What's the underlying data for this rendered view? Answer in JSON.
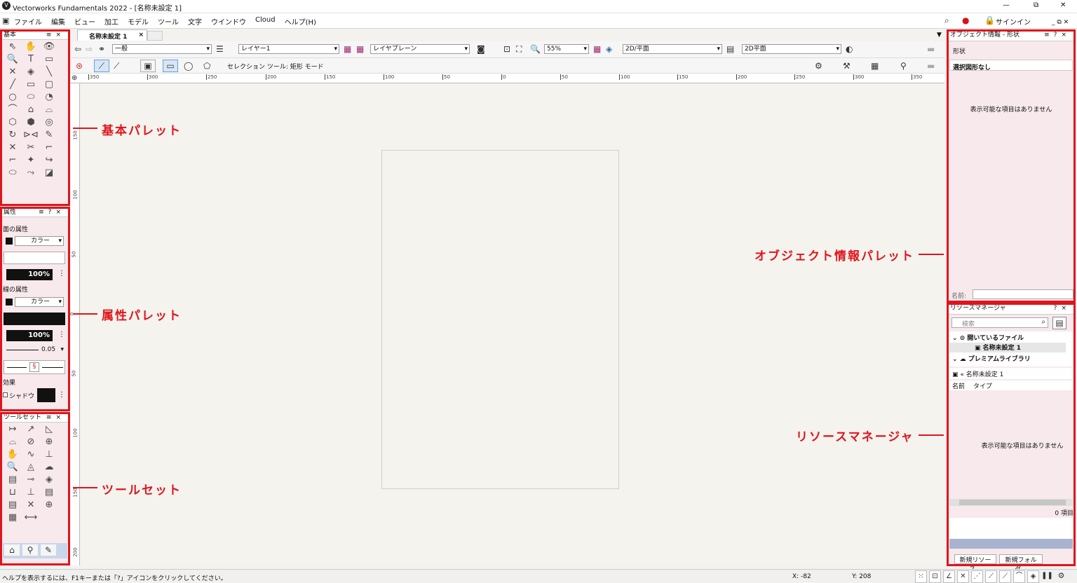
{
  "app": {
    "title": "Vectorworks Fundamentals 2022 - [名称未設定 1]",
    "signin": "サインイン",
    "window_controls": [
      "—",
      "⧉",
      "✕"
    ]
  },
  "menu": [
    "ファイル",
    "編集",
    "ビュー",
    "加工",
    "モデル",
    "ツール",
    "文字",
    "ウインドウ",
    "Cloud",
    "ヘルプ(H)"
  ],
  "doc_tab": "名称未設定 1",
  "toolbar": {
    "class_value": "一般",
    "layer_value": "レイヤー1",
    "plane_value": "レイヤプレーン",
    "zoom": "55%",
    "view_value": "2D/平面",
    "render_value": "2D平面",
    "mode_label": "セレクション ツール: 矩形 モード"
  },
  "ruler_h": [
    "350",
    "300",
    "250",
    "200",
    "150",
    "100",
    "50",
    "0",
    "50",
    "100",
    "150",
    "200",
    "250",
    "300",
    "350"
  ],
  "ruler_v": [
    "150",
    "100",
    "50",
    "0",
    "50",
    "100",
    "150",
    "200"
  ],
  "basic_palette": {
    "title": "基本",
    "tools": [
      "⇖",
      "✋",
      "👁",
      "🔍",
      "T",
      "▭",
      "✕",
      "◈",
      "╲",
      "╱",
      "▭",
      "▢",
      "○",
      "⬭",
      "◔",
      "⌒",
      "⌂",
      "⌓",
      "⬡",
      "⬢",
      "◎",
      "↻",
      "⊳⊲",
      "✎",
      "✕",
      "✂",
      "⌐",
      "⌐",
      "✦",
      "↪",
      "⬭",
      "⤳",
      "◪"
    ]
  },
  "attr_palette": {
    "title": "属性",
    "fill_label": "面の属性",
    "fill_type": "カラー",
    "opacity": "100%",
    "pen_label": "線の属性",
    "pen_type": "カラー",
    "pen_opacity": "100%",
    "line_weight": "0.05",
    "effects_label": "効果",
    "shadow_label": "シャドウ"
  },
  "toolset_palette": {
    "title": "ツールセット",
    "tools": [
      "↦",
      "↗",
      "◺",
      "⌓",
      "⊘",
      "⊕",
      "✋",
      "∿",
      "⊥",
      "🔍",
      "◬",
      "☁",
      "▤",
      "⊸",
      "◈",
      "⊔",
      "⊥",
      "▤",
      "▤",
      "✕",
      "⊕",
      "▦",
      "⟷"
    ]
  },
  "obj_info": {
    "title": "オブジェクト情報 - 形状",
    "tab": "形状",
    "selection": "選択図形なし",
    "empty": "表示可能な項目はありません",
    "name_label": "名前:"
  },
  "resource_mgr": {
    "title": "リソースマネージャ",
    "search_placeholder": "検索",
    "tree": [
      {
        "label": "開いているファイル"
      },
      {
        "label": "名称未設定 1"
      },
      {
        "label": "プレミアムライブラリ"
      }
    ],
    "current": "名称未設定 1",
    "col_name": "名前",
    "col_type": "タイプ",
    "empty": "表示可能な項目はありません",
    "count": "0 項目",
    "new_resource": "新規リソース...",
    "new_folder": "新規フォルダ..."
  },
  "callouts": {
    "basic": "基本パレット",
    "attr": "属性パレット",
    "toolset": "ツールセット",
    "obj_info": "オブジェクト情報パレット",
    "resource": "リソースマネージャ"
  },
  "status": {
    "help": "ヘルプを表示するには、F1キーまたは「?」アイコンをクリックしてください。",
    "x": "X: -82",
    "y": "Y: 208"
  },
  "colors": {
    "accent": "#e0141c",
    "palette_bg": "#f7e9ec",
    "canvas": "#f4f3ee"
  }
}
